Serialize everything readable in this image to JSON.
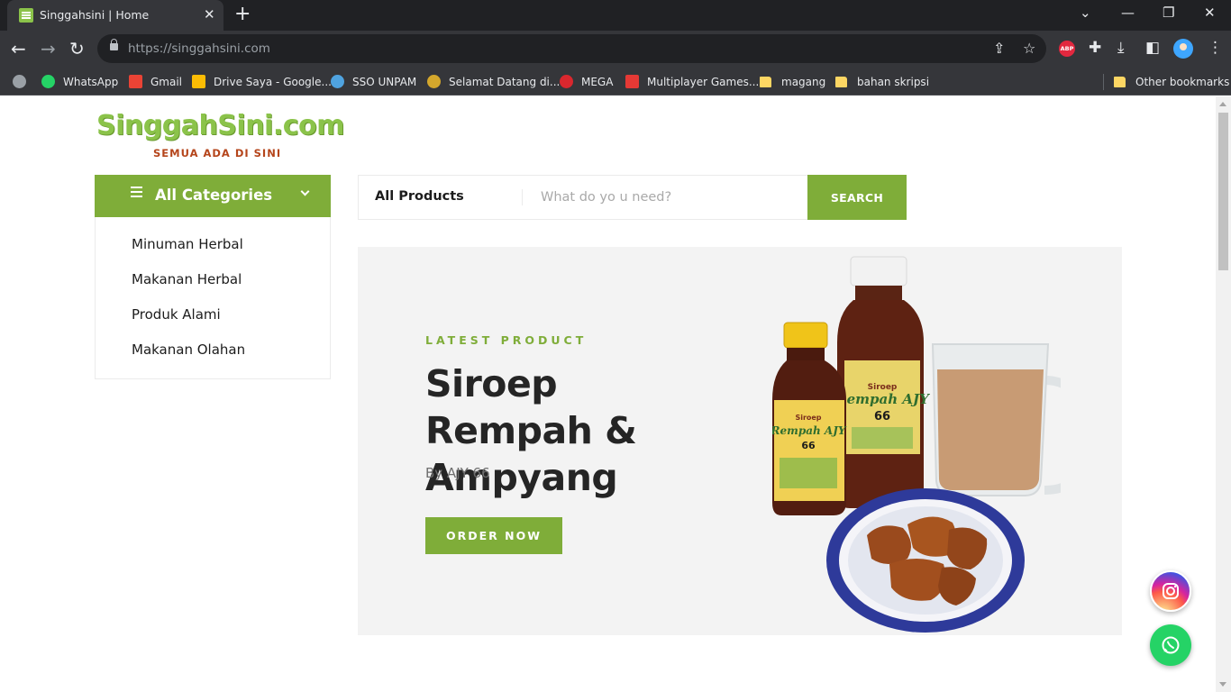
{
  "browser": {
    "tab_title": "Singgahsini | Home",
    "url": "https://singgahsini.com",
    "bookmarks": [
      {
        "label": "WhatsApp",
        "icon": "whatsapp-icon"
      },
      {
        "label": "Gmail",
        "icon": "gmail-icon"
      },
      {
        "label": "Drive Saya - Google...",
        "icon": "google-drive-icon"
      },
      {
        "label": "SSO UNPAM",
        "icon": "sso-icon"
      },
      {
        "label": "Selamat Datang di...",
        "icon": "site-icon"
      },
      {
        "label": "MEGA",
        "icon": "mega-icon"
      },
      {
        "label": "Multiplayer Games...",
        "icon": "games-icon"
      },
      {
        "label": "magang",
        "icon": "folder-icon"
      },
      {
        "label": "bahan skripsi",
        "icon": "folder-icon"
      }
    ],
    "other_bookmarks": "Other bookmarks",
    "extension_abp": "ABP"
  },
  "site": {
    "logo_text": "SinggahSini.com",
    "logo_tagline": "SEMUA ADA DI SINI"
  },
  "categories": {
    "title": "All Categories",
    "items": [
      "Minuman Herbal",
      "Makanan Herbal",
      "Produk Alami",
      "Makanan Olahan"
    ]
  },
  "search": {
    "category": "All Products",
    "placeholder": "What do yo u need?",
    "button": "SEARCH"
  },
  "hero": {
    "kicker": "LATEST PRODUCT",
    "title": "Siroep Rempah & Ampyang",
    "byline": "By AJY 66",
    "cta": "ORDER NOW",
    "image_labels": {
      "small_bottle": "Siroep Rempah AJY 66",
      "big_bottle": "Siroep Rempah AJY 66"
    }
  },
  "colors": {
    "accent": "#7fad39",
    "logo_green": "#8bc34a",
    "logo_tagline": "#b5451b",
    "hero_bg": "#f3f3f3",
    "whatsapp": "#25d366"
  }
}
